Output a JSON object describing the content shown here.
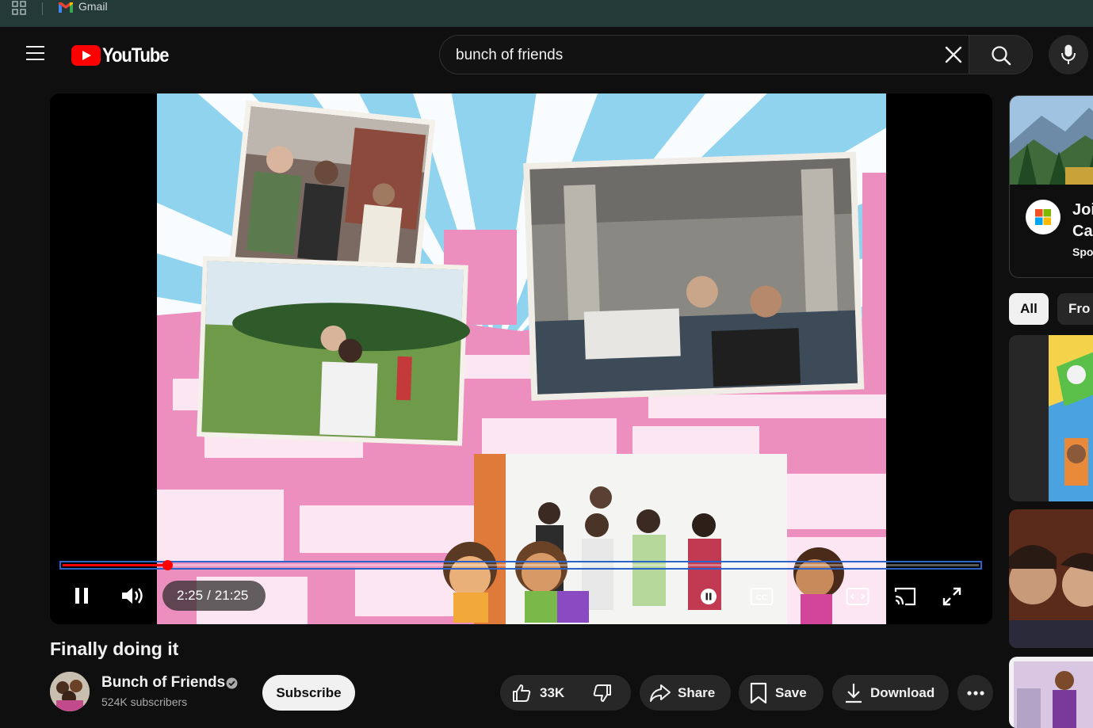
{
  "bookmarks": {
    "gmail_label": "Gmail"
  },
  "masthead": {
    "logo_text": "YouTube",
    "search_value": "bunch of friends"
  },
  "player": {
    "current_time": "2:25",
    "duration": "21:25",
    "progress_fraction": 0.114
  },
  "video": {
    "title": "Finally doing it",
    "channel_name": "Bunch of Friends",
    "subscribers": "524K subscribers",
    "subscribe_label": "Subscribe",
    "likes": "33K",
    "share_label": "Share",
    "save_label": "Save",
    "download_label": "Download"
  },
  "sidebar": {
    "ad_title_line1": "Joi",
    "ad_title_line2": "Ca",
    "ad_sponsor": "Spo",
    "chips": [
      "All",
      "Fro"
    ]
  },
  "colors": {
    "background": "#0f0f0f",
    "progress": "#ff0000",
    "bookmark_bar": "#233a36",
    "frame_pink": "#ec8fbf",
    "frame_sky": "#8fd3ee"
  }
}
